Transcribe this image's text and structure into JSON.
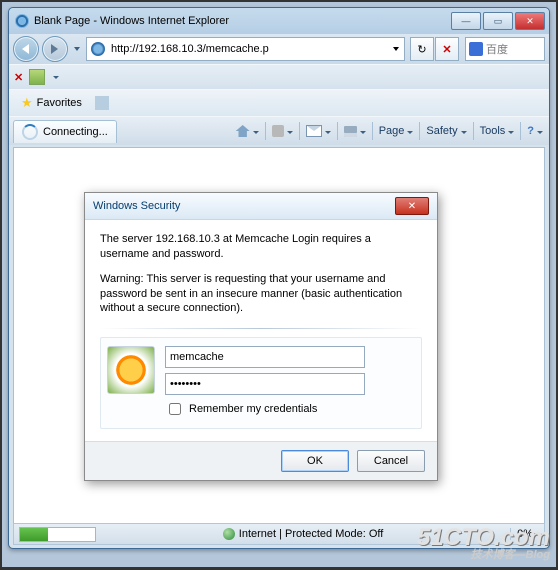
{
  "window": {
    "title": "Blank Page - Windows Internet Explorer",
    "url": "http://192.168.10.3/memcache.p",
    "search_placeholder": "百度"
  },
  "toolbar": {
    "favorites_label": "Favorites"
  },
  "tab": {
    "label": "Connecting..."
  },
  "commands": {
    "page": "Page",
    "safety": "Safety",
    "tools": "Tools"
  },
  "status": {
    "text": "Internet | Protected Mode: Off",
    "zoom": "0%"
  },
  "dialog": {
    "title": "Windows Security",
    "message": "The server 192.168.10.3 at Memcache Login requires a username and password.",
    "warning": "Warning: This server is requesting that your username and password be sent in an insecure manner (basic authentication without a secure connection).",
    "username": "memcache",
    "password": "••••••••",
    "remember_label": "Remember my credentials",
    "ok": "OK",
    "cancel": "Cancel"
  },
  "watermark": {
    "main": "51CTO.com",
    "sub": "技术博客—Blog"
  }
}
